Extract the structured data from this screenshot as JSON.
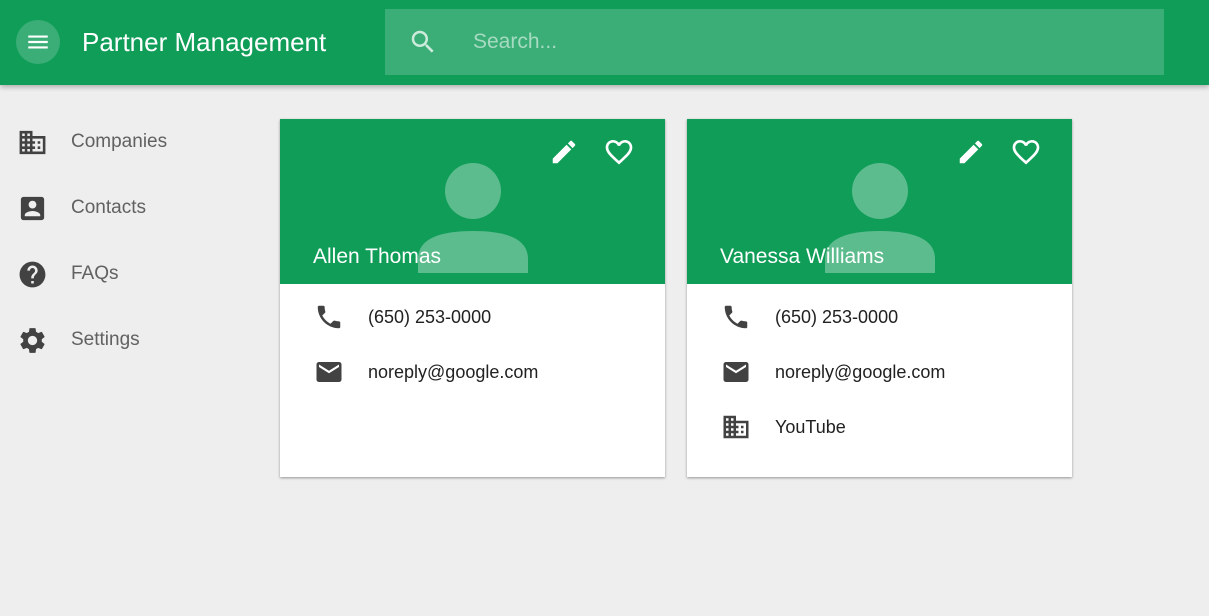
{
  "colors": {
    "primary": "#0f9d58",
    "background": "#eeeeee",
    "card_background": "#ffffff",
    "nav_text": "#616161",
    "icon": "#424242"
  },
  "appbar": {
    "menu_icon": "hamburger-menu-icon",
    "title": "Partner Management",
    "search": {
      "icon": "search-icon",
      "placeholder": "Search...",
      "value": ""
    }
  },
  "sidebar": {
    "items": [
      {
        "label": "Companies",
        "icon": "building-icon"
      },
      {
        "label": "Contacts",
        "icon": "contact-card-icon"
      },
      {
        "label": "FAQs",
        "icon": "help-circle-icon"
      },
      {
        "label": "Settings",
        "icon": "gear-icon"
      }
    ]
  },
  "contacts": [
    {
      "name": "Allen Thomas",
      "avatar_icon": "person-silhouette-icon",
      "actions": [
        "pencil-edit-icon",
        "heart-outline-icon"
      ],
      "phone": "(650) 253-0000",
      "email": "noreply@google.com"
    },
    {
      "name": "Vanessa Williams",
      "avatar_icon": "person-silhouette-icon",
      "actions": [
        "pencil-edit-icon",
        "heart-outline-icon"
      ],
      "phone": "(650) 253-0000",
      "email": "noreply@google.com",
      "company": "YouTube"
    }
  ]
}
